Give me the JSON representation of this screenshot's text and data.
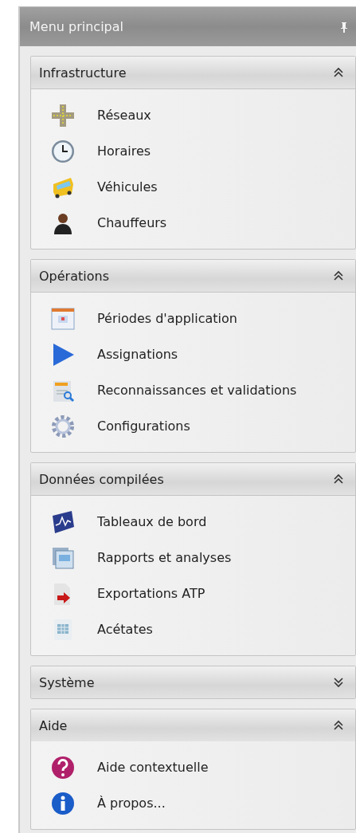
{
  "panel": {
    "title": "Menu principal"
  },
  "groups": [
    {
      "title": "Infrastructure",
      "expanded": true,
      "items": [
        {
          "label": "Réseaux"
        },
        {
          "label": "Horaires"
        },
        {
          "label": "Véhicules"
        },
        {
          "label": "Chauffeurs"
        }
      ]
    },
    {
      "title": "Opérations",
      "expanded": true,
      "items": [
        {
          "label": "Périodes d'application"
        },
        {
          "label": "Assignations"
        },
        {
          "label": "Reconnaissances et validations"
        },
        {
          "label": "Configurations"
        }
      ]
    },
    {
      "title": "Données compilées",
      "expanded": true,
      "items": [
        {
          "label": "Tableaux de bord"
        },
        {
          "label": "Rapports et analyses"
        },
        {
          "label": "Exportations ATP"
        },
        {
          "label": "Acétates"
        }
      ]
    },
    {
      "title": "Système",
      "expanded": false
    },
    {
      "title": "Aide",
      "expanded": true,
      "items": [
        {
          "label": "Aide contextuelle"
        },
        {
          "label": "À propos..."
        }
      ]
    }
  ]
}
